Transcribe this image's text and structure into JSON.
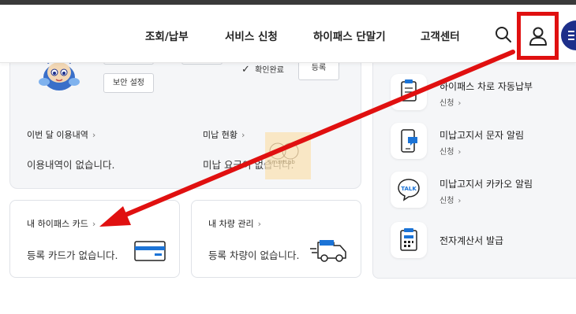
{
  "nav": {
    "items": [
      "조회/납부",
      "서비스 신청",
      "하이패스 단말기",
      "고객센터"
    ]
  },
  "profile": {
    "security_button": "보안 설정",
    "check_label": "확인완료",
    "register_button": "등록"
  },
  "usage": {
    "label": "이번 달 이용내역",
    "value": "이용내역이 없습니다."
  },
  "unpaid": {
    "label": "미납 현황",
    "value": "미납 요금이 없습니다."
  },
  "watermark": "SmartLab",
  "card_section": {
    "label": "내 하이패스 카드",
    "value": "등록 카드가 없습니다."
  },
  "vehicle_section": {
    "label": "내 차량 관리",
    "value": "등록 차량이 없습니다."
  },
  "services": [
    {
      "title": "하이패스 차로 자동납부",
      "sub": "신청",
      "icon": "clipboard-icon"
    },
    {
      "title": "미납고지서 문자 알림",
      "sub": "신청",
      "icon": "phone-message-icon"
    },
    {
      "title": "미납고지서 카카오 알림",
      "sub": "신청",
      "icon": "talk-bubble-icon"
    },
    {
      "title": "전자계산서 발급",
      "sub": "",
      "icon": "calculator-document-icon"
    }
  ],
  "talk_icon_text": "TALK",
  "colors": {
    "highlight": "#e01010",
    "brand": "#1d2f8a",
    "accent_blue": "#1b73d6"
  }
}
